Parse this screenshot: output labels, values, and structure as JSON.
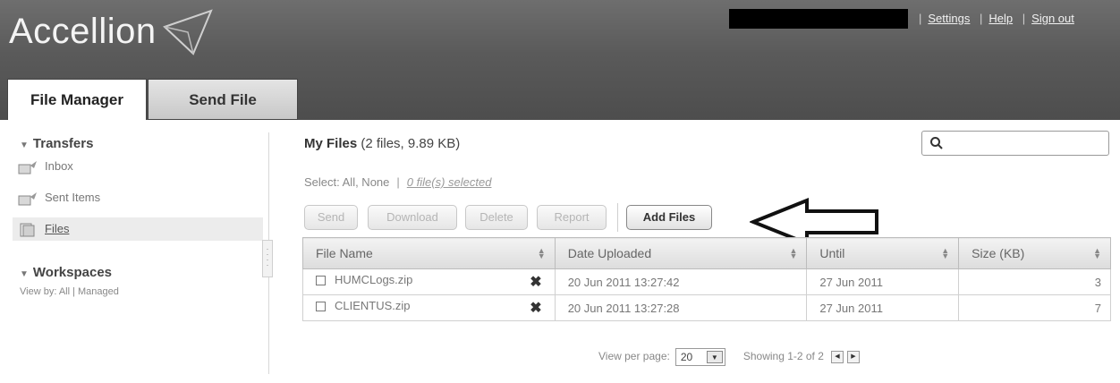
{
  "header": {
    "logo_text": "Accellion",
    "links": [
      "Settings",
      "Help",
      "Sign out"
    ]
  },
  "tabs": [
    {
      "label": "File Manager",
      "active": true
    },
    {
      "label": "Send File",
      "active": false
    }
  ],
  "sidebar": {
    "transfers_heading": "Transfers",
    "items": [
      {
        "label": "Inbox",
        "icon": "inbox-icon"
      },
      {
        "label": "Sent Items",
        "icon": "sent-items-icon"
      },
      {
        "label": "Files",
        "icon": "files-icon",
        "active": true
      }
    ],
    "workspaces_heading": "Workspaces",
    "workspaces_view": "View by: All | Managed"
  },
  "main": {
    "title": "My Files",
    "title_detail": "(2 files, 9.89 KB)",
    "search_placeholder": "",
    "select_label": "Select: All, None",
    "selected_count": "0 file(s) selected",
    "buttons": [
      {
        "label": "Send",
        "enabled": false
      },
      {
        "label": "Download",
        "enabled": false
      },
      {
        "label": "Delete",
        "enabled": false
      },
      {
        "label": "Report",
        "enabled": false
      },
      {
        "label": "Add Files",
        "enabled": true
      }
    ],
    "table": {
      "columns": [
        "File Name",
        "Date Uploaded",
        "Until",
        "Size (KB)"
      ],
      "rows": [
        {
          "name": "HUMCLogs.zip",
          "uploaded": "20 Jun 2011 13:27:42",
          "until": "27 Jun 2011",
          "size": "3"
        },
        {
          "name": "CLIENTUS.zip",
          "uploaded": "20 Jun 2011 13:27:28",
          "until": "27 Jun 2011",
          "size": "7"
        }
      ]
    },
    "pager": {
      "view_per_page_label": "View per page:",
      "per_page_value": "20",
      "showing": "Showing 1-2 of 2"
    }
  },
  "colors": {
    "header_bg": "#5a5a5a",
    "active_tab_bg": "#ffffff",
    "inactive_tab_bg": "#d4d4d4"
  }
}
